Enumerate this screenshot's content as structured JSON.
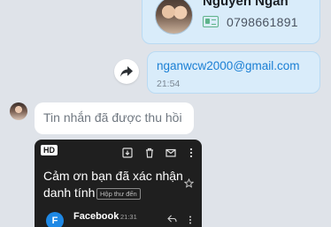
{
  "contact_card": {
    "name": "Nguyen Ngan",
    "phone": "0798661891"
  },
  "email_message": {
    "email": "nganwcw2000@gmail.com",
    "time": "21:54"
  },
  "recalled_message": {
    "text": "Tin nhắn đã được thu hồi"
  },
  "gmail_screenshot": {
    "hd_label": "HD",
    "subject": "Cảm ơn bạn đã xác nhận danh tính",
    "inbox_label": "Hộp thư đến",
    "sender": "Facebook",
    "sender_initial": "F",
    "time": "21:31"
  },
  "colors": {
    "bubble_self": "#d9ecfa",
    "link": "#1a7fd4",
    "background": "#dfe3e9"
  }
}
